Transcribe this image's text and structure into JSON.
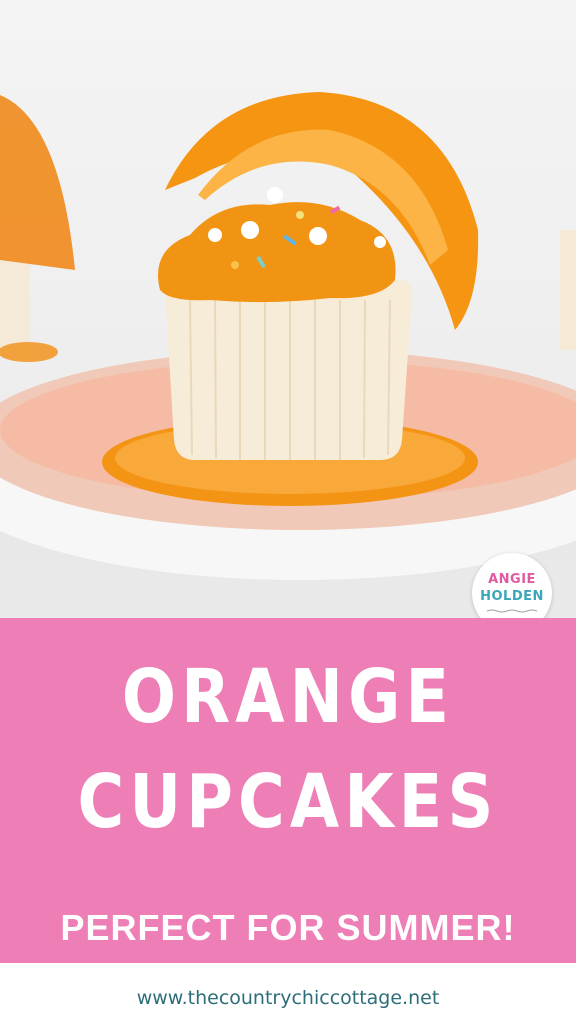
{
  "image": {
    "subject": "orange-cupcake-photo"
  },
  "title": {
    "line1": "ORANGE",
    "line2": "CUPCAKES"
  },
  "subtitle": "PERFECT FOR SUMMER!",
  "website": "www.thecountrychiccottage.net",
  "logo": {
    "line1": "ANGIE",
    "line2": "HOLDEN"
  },
  "colors": {
    "banner": "#ee7fb6",
    "title_text": "#ffffff",
    "url_text": "#2e6d7a",
    "logo_pink": "#e05aa0",
    "logo_teal": "#3aa6b9"
  }
}
